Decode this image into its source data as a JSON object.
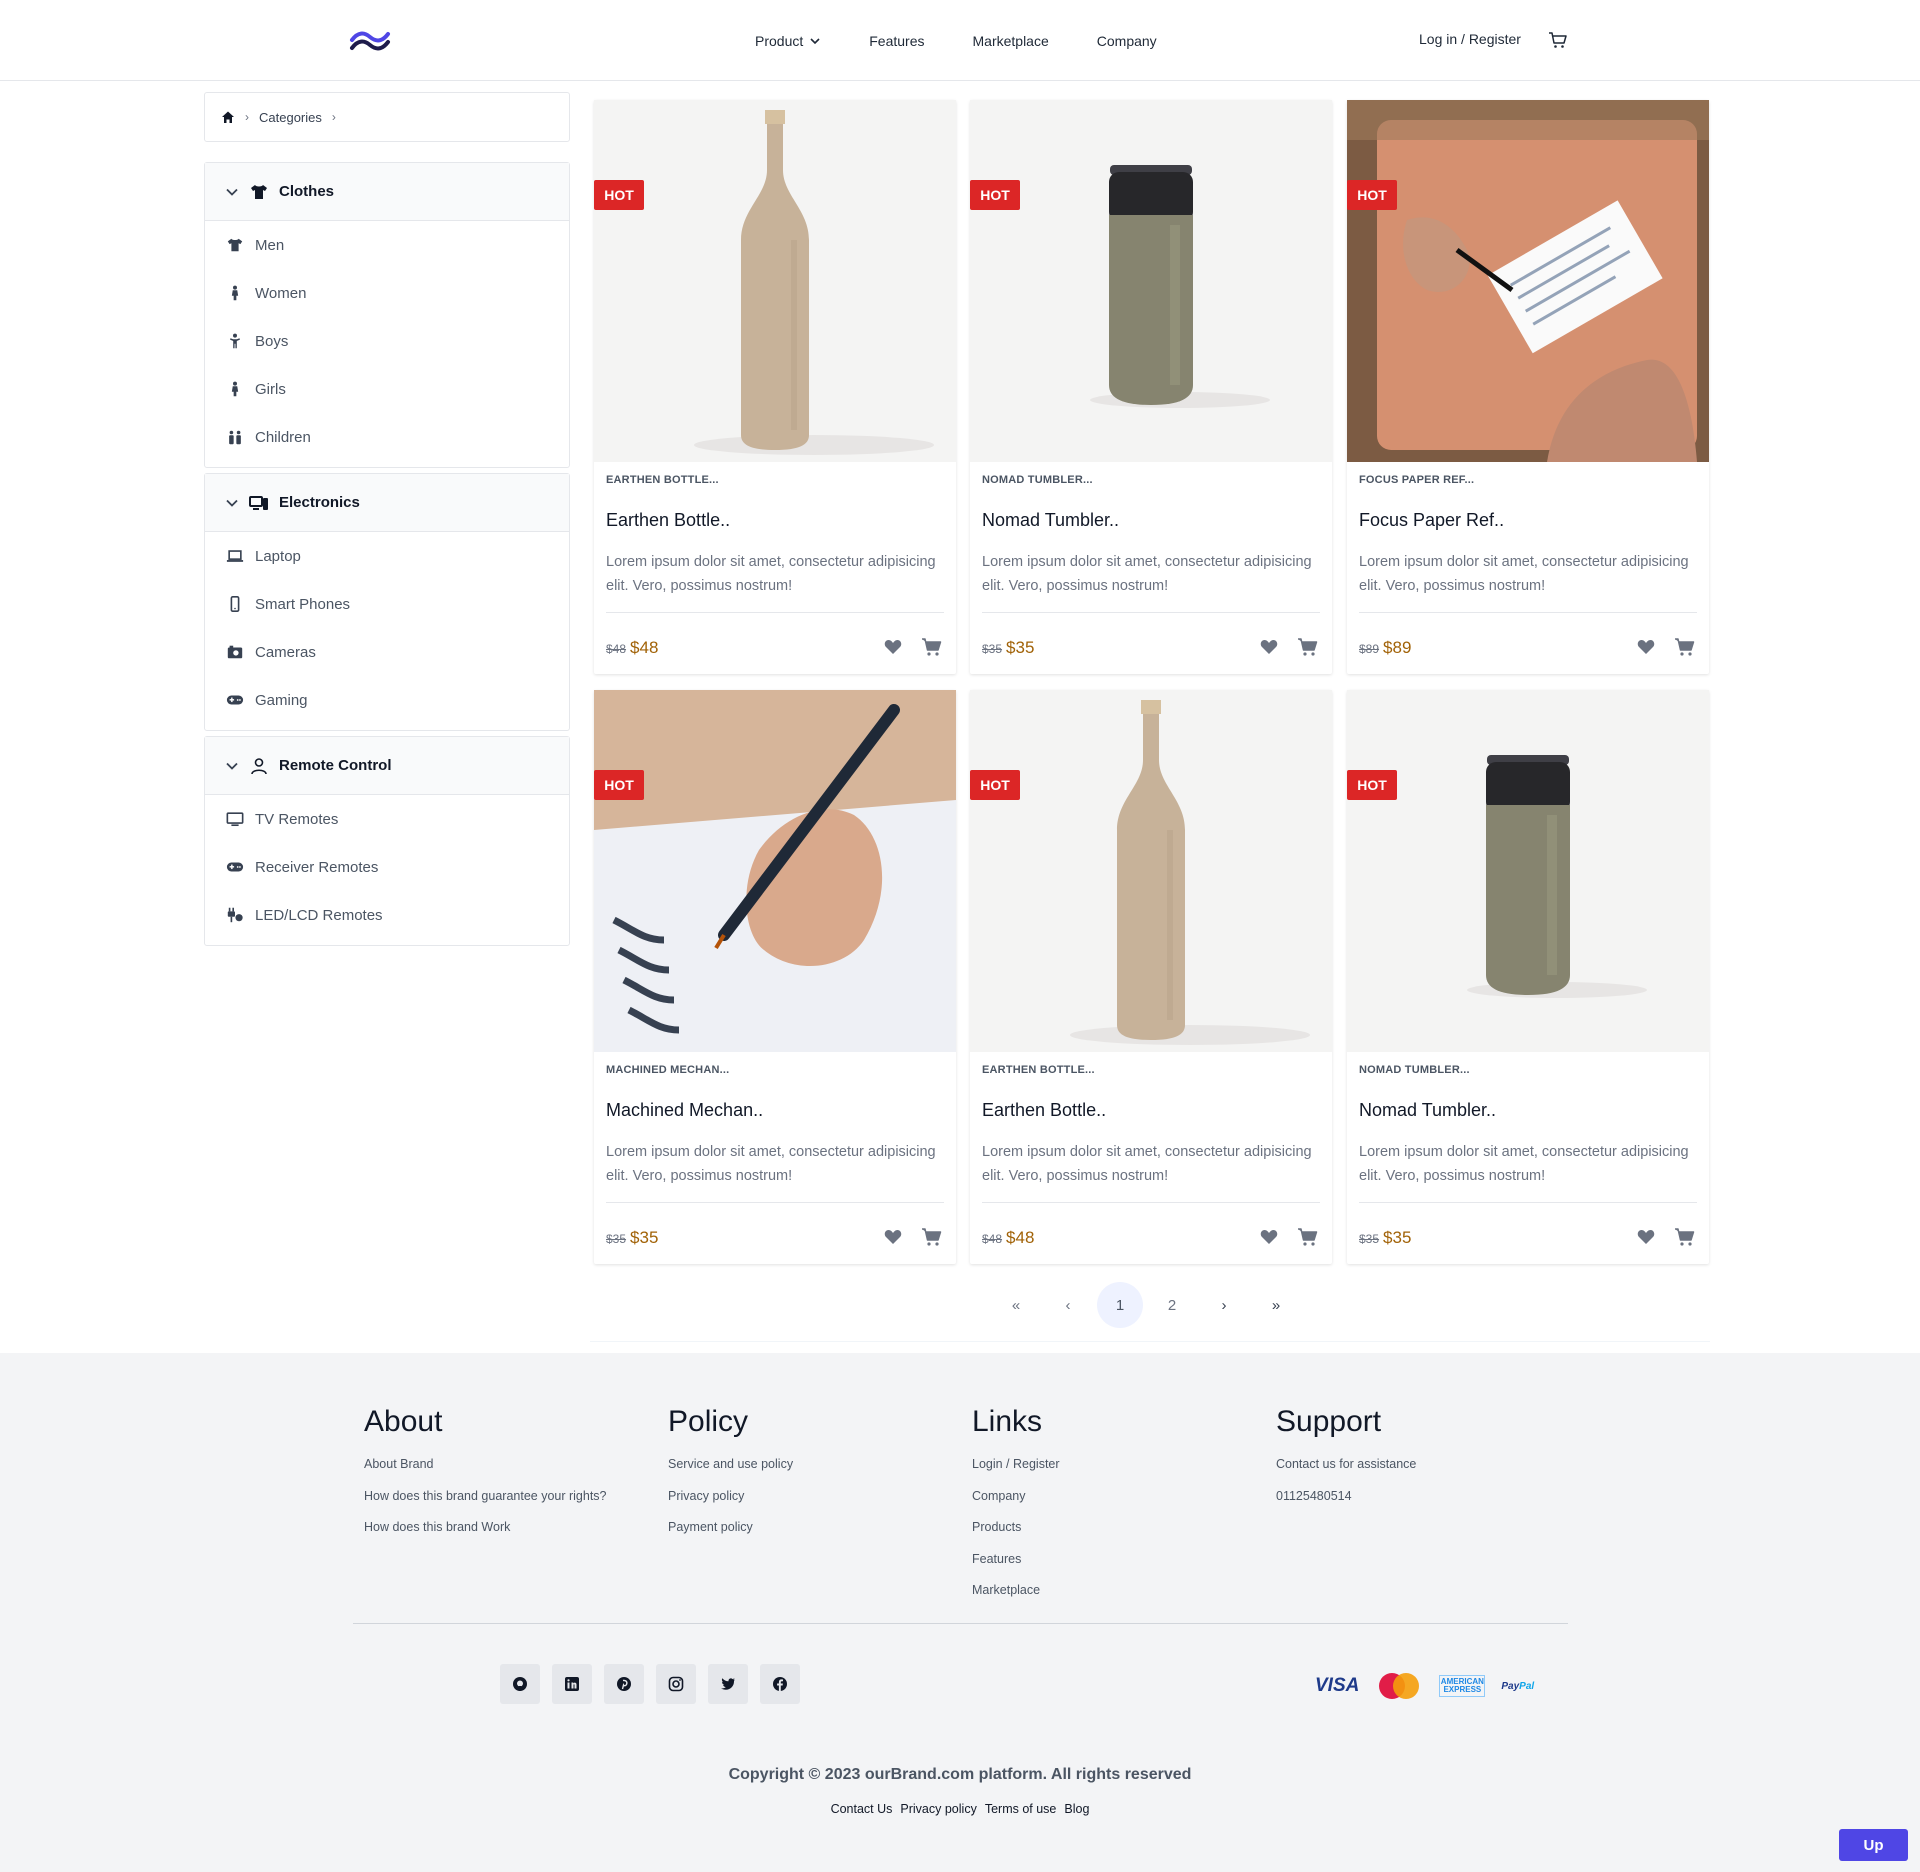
{
  "header": {
    "nav": [
      "Product",
      "Features",
      "Marketplace",
      "Company"
    ],
    "login_label": "Log in / Register"
  },
  "breadcrumb": {
    "current": "Categories"
  },
  "categories": [
    {
      "title": "Clothes",
      "icon": "shirt-icon",
      "items": [
        {
          "label": "Men",
          "icon": "shirt-icon"
        },
        {
          "label": "Women",
          "icon": "person-female-icon"
        },
        {
          "label": "Boys",
          "icon": "child-icon"
        },
        {
          "label": "Girls",
          "icon": "person-female-icon"
        },
        {
          "label": "Children",
          "icon": "children-icon"
        }
      ]
    },
    {
      "title": "Electronics",
      "icon": "devices-icon",
      "items": [
        {
          "label": "Laptop",
          "icon": "laptop-icon"
        },
        {
          "label": "Smart Phones",
          "icon": "phone-icon"
        },
        {
          "label": "Cameras",
          "icon": "camera-icon"
        },
        {
          "label": "Gaming",
          "icon": "gamepad-icon"
        }
      ]
    },
    {
      "title": "Remote Control",
      "icon": "user-icon",
      "items": [
        {
          "label": "TV Remotes",
          "icon": "tv-icon"
        },
        {
          "label": "Receiver Remotes",
          "icon": "gamepad-icon"
        },
        {
          "label": "LED/LCD Remotes",
          "icon": "plug-icon"
        }
      ]
    }
  ],
  "products": [
    {
      "badge": "HOT",
      "subtitle": "EARTHEN BOTTLE...",
      "name": "Earthen Bottle..",
      "desc": "Lorem ipsum dolor sit amet, consectetur adipisicing elit. Vero, possimus nostrum!",
      "old_price": "$48",
      "price": "$48",
      "image": "bottle"
    },
    {
      "badge": "HOT",
      "subtitle": "NOMAD TUMBLER...",
      "name": "Nomad Tumbler..",
      "desc": "Lorem ipsum dolor sit amet, consectetur adipisicing elit. Vero, possimus nostrum!",
      "old_price": "$35",
      "price": "$35",
      "image": "tumbler"
    },
    {
      "badge": "HOT",
      "subtitle": "FOCUS PAPER REF...",
      "name": "Focus Paper Ref..",
      "desc": "Lorem ipsum dolor sit amet, consectetur adipisicing elit. Vero, possimus nostrum!",
      "old_price": "$89",
      "price": "$89",
      "image": "paper"
    },
    {
      "badge": "HOT",
      "subtitle": "MACHINED MECHAN...",
      "name": "Machined Mechan..",
      "desc": "Lorem ipsum dolor sit amet, consectetur adipisicing elit. Vero, possimus nostrum!",
      "old_price": "$35",
      "price": "$35",
      "image": "pen"
    },
    {
      "badge": "HOT",
      "subtitle": "EARTHEN BOTTLE...",
      "name": "Earthen Bottle..",
      "desc": "Lorem ipsum dolor sit amet, consectetur adipisicing elit. Vero, possimus nostrum!",
      "old_price": "$48",
      "price": "$48",
      "image": "bottle"
    },
    {
      "badge": "HOT",
      "subtitle": "NOMAD TUMBLER...",
      "name": "Nomad Tumbler..",
      "desc": "Lorem ipsum dolor sit amet, consectetur adipisicing elit. Vero, possimus nostrum!",
      "old_price": "$35",
      "price": "$35",
      "image": "tumbler"
    }
  ],
  "pagination": {
    "pages": [
      "1",
      "2"
    ],
    "current": "1"
  },
  "footer": {
    "columns": [
      {
        "title": "About",
        "links": [
          "About Brand",
          "How does this brand guarantee your rights?",
          "How does this brand Work"
        ]
      },
      {
        "title": "Policy",
        "links": [
          "Service and use policy",
          "Privacy policy",
          "Payment policy"
        ]
      },
      {
        "title": "Links",
        "links": [
          "Login / Register",
          "Company",
          "Products",
          "Features",
          "Marketplace"
        ]
      },
      {
        "title": "Support",
        "links": [
          "Contact us for assistance",
          "01125480514"
        ]
      }
    ],
    "socials": [
      "github-icon",
      "linkedin-icon",
      "pinterest-icon",
      "instagram-icon",
      "twitter-icon",
      "facebook-icon"
    ],
    "payments": {
      "visa": "VISA",
      "mastercard": "MasterCard",
      "amex": "AMERICAN EXPRESS",
      "paypal_a": "Pay",
      "paypal_b": "Pal"
    },
    "copyright": "Copyright © 2023 ourBrand.com platform. All rights reserved",
    "bottom_links": [
      "Contact Us",
      "Privacy policy",
      "Terms of use",
      "Blog"
    ]
  },
  "up_button": "Up",
  "colors": {
    "accent": "#4f46e5",
    "hot": "#dc2626",
    "price": "#a16207"
  }
}
